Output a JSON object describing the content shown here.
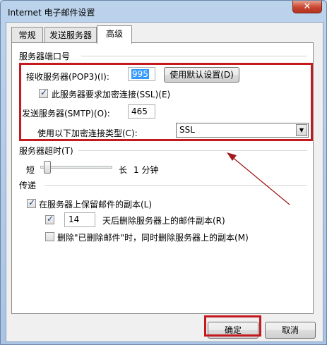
{
  "window": {
    "title": "Internet 电子邮件设置",
    "close_glyph": "✕"
  },
  "tabs": [
    {
      "label": "常规",
      "active": false
    },
    {
      "label": "发送服务器",
      "active": false
    },
    {
      "label": "高级",
      "active": true
    }
  ],
  "ports": {
    "group_label": "服务器端口号",
    "incoming_label": "接收服务器(POP3)(I):",
    "incoming_value": "995",
    "use_defaults_label": "使用默认设置(D)",
    "ssl_required_label": "此服务器要求加密连接(SSL)(E)",
    "ssl_required_checked": true,
    "outgoing_label": "发送服务器(SMTP)(O):",
    "outgoing_value": "465",
    "encryption_label": "使用以下加密连接类型(C):",
    "encryption_value": "SSL"
  },
  "timeout": {
    "group_label": "服务器超时(T)",
    "short_label": "短",
    "long_label": "长",
    "value_text": "1 分钟",
    "level_fraction": 0.05
  },
  "delivery": {
    "group_label": "传递",
    "leave_copy_label": "在服务器上保留邮件的副本(L)",
    "leave_copy_checked": true,
    "remove_after_checked": true,
    "remove_after_days": "14",
    "remove_after_label": "天后删除服务器上的邮件副本(R)",
    "remove_deleted_label": "删除\"已删除邮件\"时，同时删除服务器上的副本(M)",
    "remove_deleted_checked": false
  },
  "footer": {
    "ok_label": "确定",
    "cancel_label": "取消"
  },
  "colors": {
    "highlight_box": "#c3191f",
    "arrow": "#a11a1a"
  }
}
